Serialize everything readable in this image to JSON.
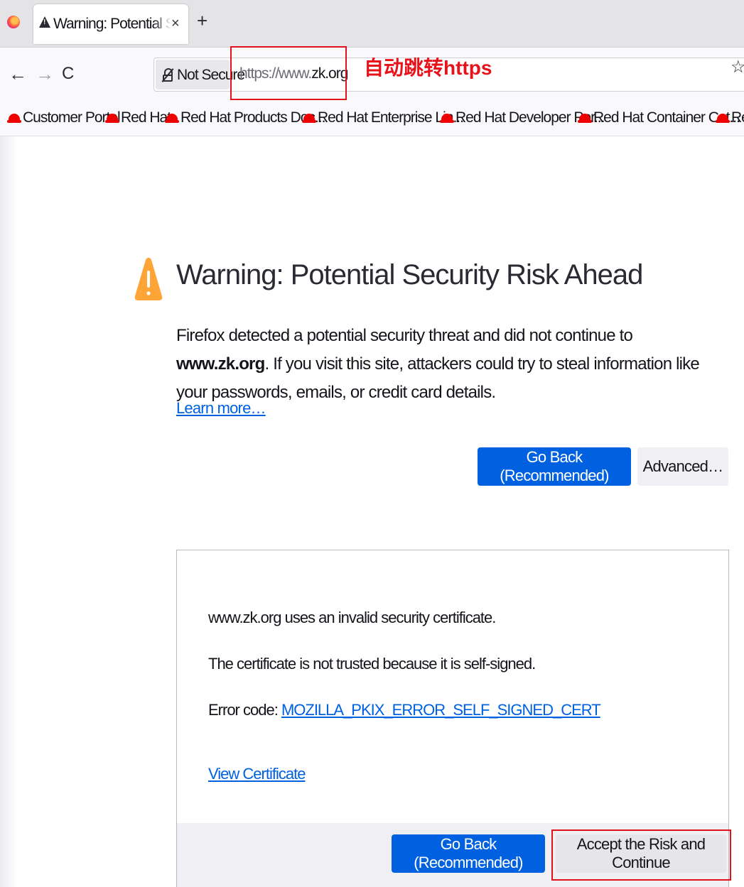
{
  "tab": {
    "title": "Warning: Potential Security Risk Ahead",
    "close_glyph": "×",
    "new_tab_glyph": "+"
  },
  "nav": {
    "back_glyph": "←",
    "forward_glyph": "→",
    "reload_glyph": "C",
    "identity_label": "Not Secure",
    "url_scheme": "https://",
    "url_prefix": "www.",
    "url_host": "zk.org",
    "star_glyph": "☆"
  },
  "annotation": {
    "label": "自动跳转https",
    "color": "#e0121b"
  },
  "bookmarks": [
    {
      "label": "Customer Portal"
    },
    {
      "label": "Red Hat"
    },
    {
      "label": "Red Hat Products Doc..."
    },
    {
      "label": "Red Hat Enterprise Lin..."
    },
    {
      "label": "Red Hat Developer Por..."
    },
    {
      "label": "Red Hat Container Cat..."
    },
    {
      "label": "Red Hat"
    }
  ],
  "page": {
    "title": "Warning: Potential Security Risk Ahead",
    "intro_before": "Firefox detected a potential security threat and did not continue to ",
    "intro_host": "www.zk.org",
    "intro_after": ". If you visit this site, attackers could try to steal information like your passwords, emails, or credit card details.",
    "learn_more": "Learn more…",
    "go_back_label": "Go Back (Recommended)",
    "advanced_label": "Advanced…"
  },
  "advanced": {
    "invalid_cert": "www.zk.org uses an invalid security certificate.",
    "not_trusted": "The certificate is not trusted because it is self-signed.",
    "error_code_prefix": "Error code: ",
    "error_code": "MOZILLA_PKIX_ERROR_SELF_SIGNED_CERT",
    "view_certificate": "View Certificate",
    "go_back_label": "Go Back (Recommended)",
    "accept_label": "Accept the Risk and Continue"
  },
  "colors": {
    "primary_button": "#0061e0",
    "warning_icon": "#ffa436",
    "link": "#0061e0"
  }
}
